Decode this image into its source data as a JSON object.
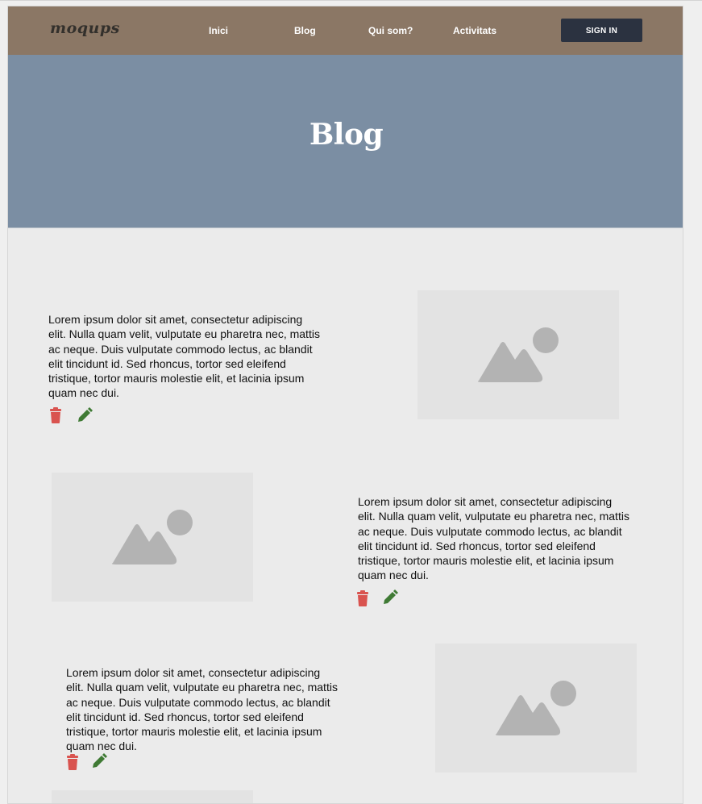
{
  "header": {
    "logo": "moqups",
    "nav": [
      "Inici",
      "Blog",
      "Qui som?",
      "Activitats"
    ],
    "sign_in_label": "SIGN IN"
  },
  "hero": {
    "title": "Blog"
  },
  "posts": [
    {
      "text": "Lorem ipsum dolor sit amet, consectetur adipiscing elit. Nulla quam velit, vulputate eu pharetra nec, mattis ac neque. Duis vulputate commodo lectus, ac blandit elit tincidunt id. Sed rhoncus, tortor sed eleifend tristique, tortor mauris molestie elit, et lacinia ipsum quam nec dui.",
      "image": "image-placeholder-icon"
    },
    {
      "text": "Lorem ipsum dolor sit amet, consectetur adipiscing elit. Nulla quam velit, vulputate eu pharetra nec, mattis ac neque. Duis vulputate commodo lectus, ac blandit elit tincidunt id. Sed rhoncus, tortor sed eleifend tristique, tortor mauris molestie elit, et lacinia ipsum quam nec dui.",
      "image": "image-placeholder-icon"
    },
    {
      "text": "Lorem ipsum dolor sit amet, consectetur adipiscing elit. Nulla quam velit, vulputate eu pharetra nec, mattis ac neque. Duis vulputate commodo lectus, ac blandit elit tincidunt id. Sed rhoncus, tortor sed eleifend tristique, tortor mauris molestie elit, et lacinia ipsum quam nec dui.",
      "image": "image-placeholder-icon"
    }
  ],
  "icons": {
    "delete": "trash-icon",
    "edit": "pencil-icon"
  },
  "colors": {
    "navbar": "#8b7765",
    "hero": "#7b8ea3",
    "sign_in": "#2b3240",
    "delete_icon": "#d9534f",
    "edit_icon": "#3f7a34",
    "placeholder": "#b3b3b3"
  }
}
